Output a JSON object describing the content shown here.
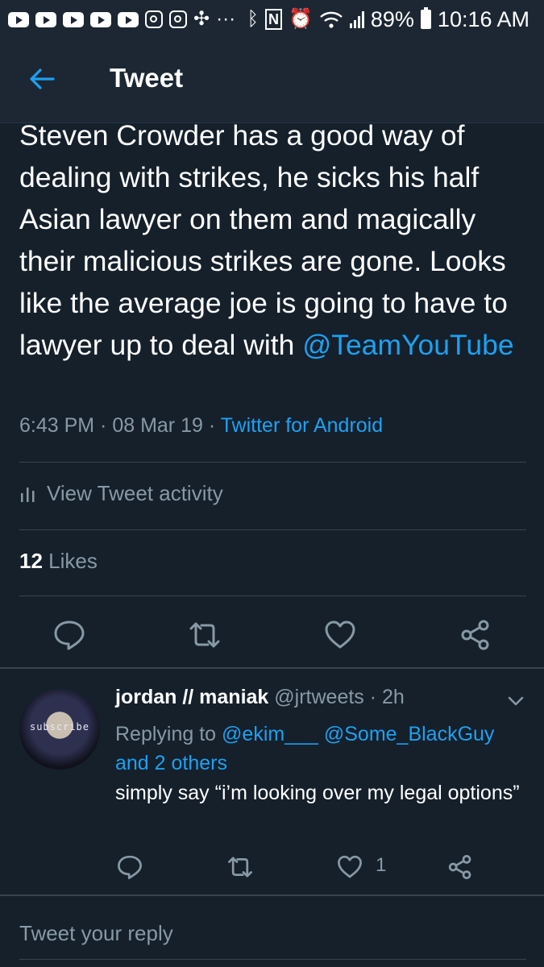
{
  "status_bar": {
    "battery": "89%",
    "time": "10:16 AM",
    "dots": "···",
    "icons": [
      "youtube-icon",
      "youtube-icon",
      "youtube-icon",
      "youtube-icon",
      "youtube-icon",
      "instagram-icon",
      "instagram-icon",
      "pinwheel-icon",
      "bluetooth-icon",
      "nfc-icon",
      "alarm-icon",
      "wifi-icon",
      "signal-icon",
      "battery-icon"
    ]
  },
  "app_bar": {
    "title": "Tweet"
  },
  "tweet": {
    "text_before": "Steven Crowder has a good way of dealing with strikes, he sicks his half Asian lawyer on them and magically their malicious strikes are gone. Looks like the average joe is going to have to lawyer up to deal with ",
    "mention": "@TeamYouTube",
    "time": "6:43 PM",
    "sep1": " · ",
    "date": "08 Mar 19",
    "sep2": " · ",
    "source": "Twitter for Android",
    "activity_label": "View Tweet activity",
    "likes_count": "12",
    "likes_label": "Likes"
  },
  "reply": {
    "avatar_text": "subscribe",
    "name": "jordan // maniak",
    "handle": "@jrtweets",
    "sep": " · ",
    "time": "2h",
    "replying_prefix": "Replying to ",
    "replying_to_1": "@ekim___",
    "replying_to_2": "@Some_BlackGuy",
    "replying_others": "and 2 others",
    "text": "simply say “i’m looking over my legal options”",
    "like_count": "1"
  },
  "composer": {
    "placeholder": "Tweet your reply"
  },
  "colors": {
    "background": "#15202b",
    "bar": "#1c2733",
    "accent": "#1da1f2",
    "muted": "#8899a6",
    "divider": "#38444d"
  }
}
